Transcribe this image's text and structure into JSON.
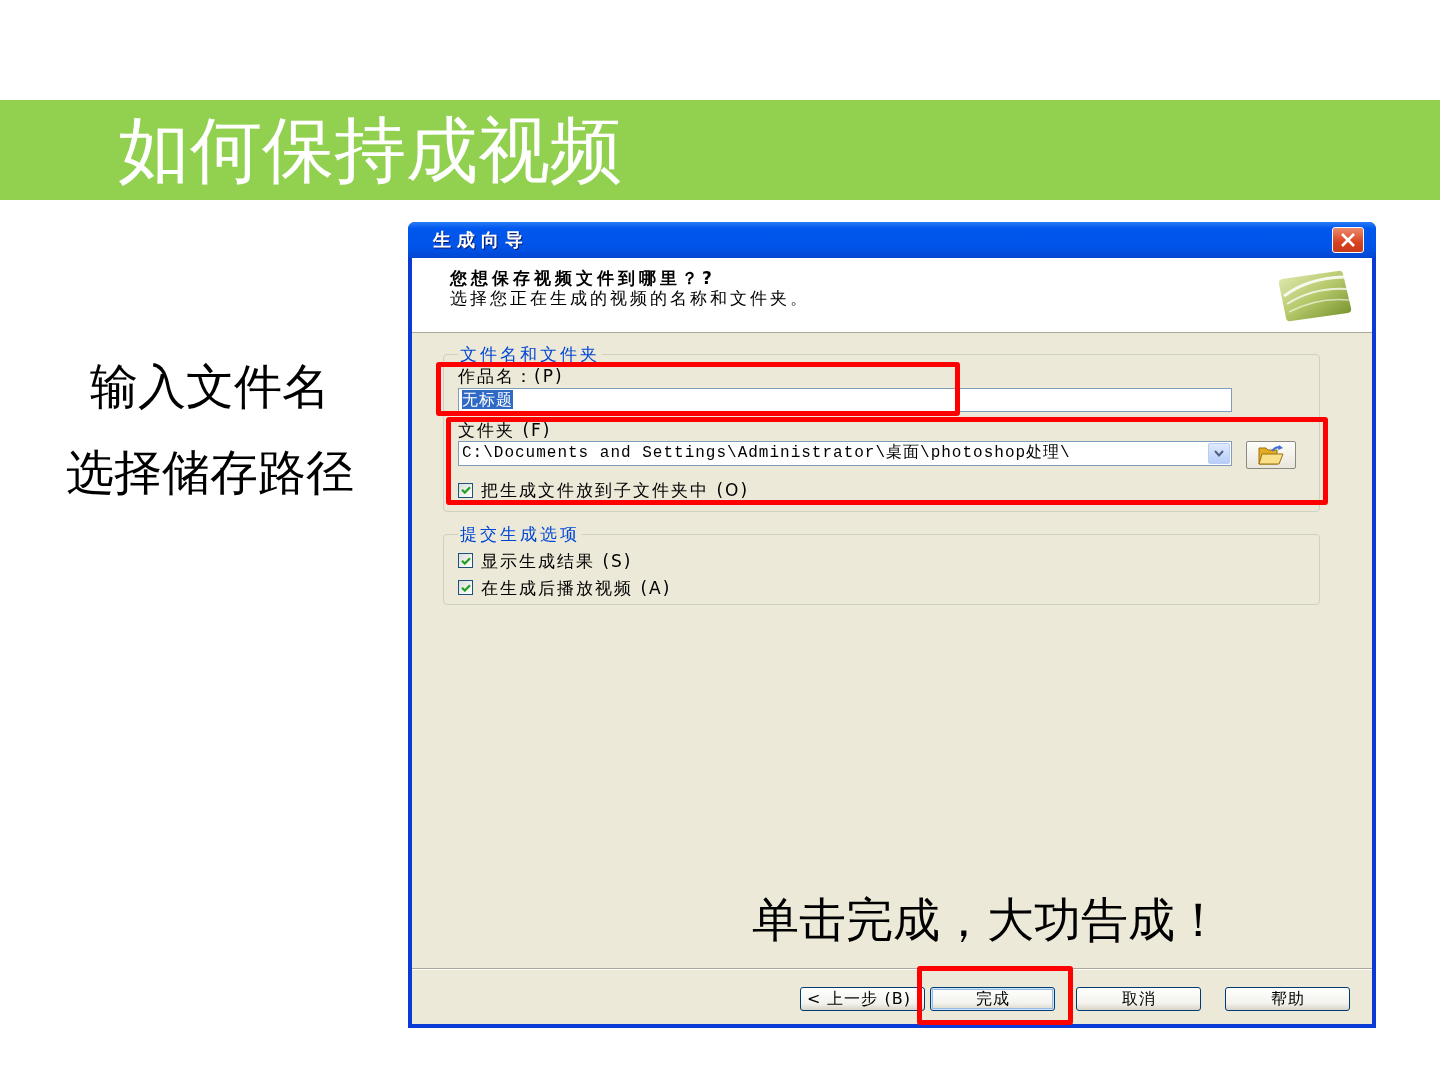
{
  "slide": {
    "title": "如何保持成视频"
  },
  "notes": [
    "输入文件名",
    "选择储存路径"
  ],
  "dialog": {
    "title": "生成向导",
    "header": {
      "heading": "您想保存视频文件到哪里？?",
      "subtitle": "选择您正在生成的视频的名称和文件夹。"
    },
    "file_group": {
      "title": "文件名和文件夹",
      "name_field": {
        "label": "作品名：(P)",
        "value": "无标题",
        "value_selected": true,
        "highlighted": true
      },
      "folder_field": {
        "label": "文件夹 (F)",
        "value": "C:\\Documents and Settings\\Administrator\\桌面\\photoshop处理\\",
        "highlighted": true
      },
      "subfolder_option": {
        "label": "把生成文件放到子文件夹中 (O)",
        "checked": true
      }
    },
    "options_group": {
      "title": "提交生成选项",
      "options": [
        {
          "label": "显示生成结果 (S)",
          "checked": true
        },
        {
          "label": "在生成后播放视频 (A)",
          "checked": true
        }
      ]
    },
    "buttons": [
      {
        "label": "< 上一步 (B)",
        "default": false,
        "highlighted": false
      },
      {
        "label": "完成",
        "default": true,
        "highlighted": true
      },
      {
        "label": "取消",
        "default": false,
        "highlighted": false
      },
      {
        "label": "帮助",
        "default": false,
        "highlighted": false
      }
    ]
  },
  "callout": "单击完成，大功告成！"
}
